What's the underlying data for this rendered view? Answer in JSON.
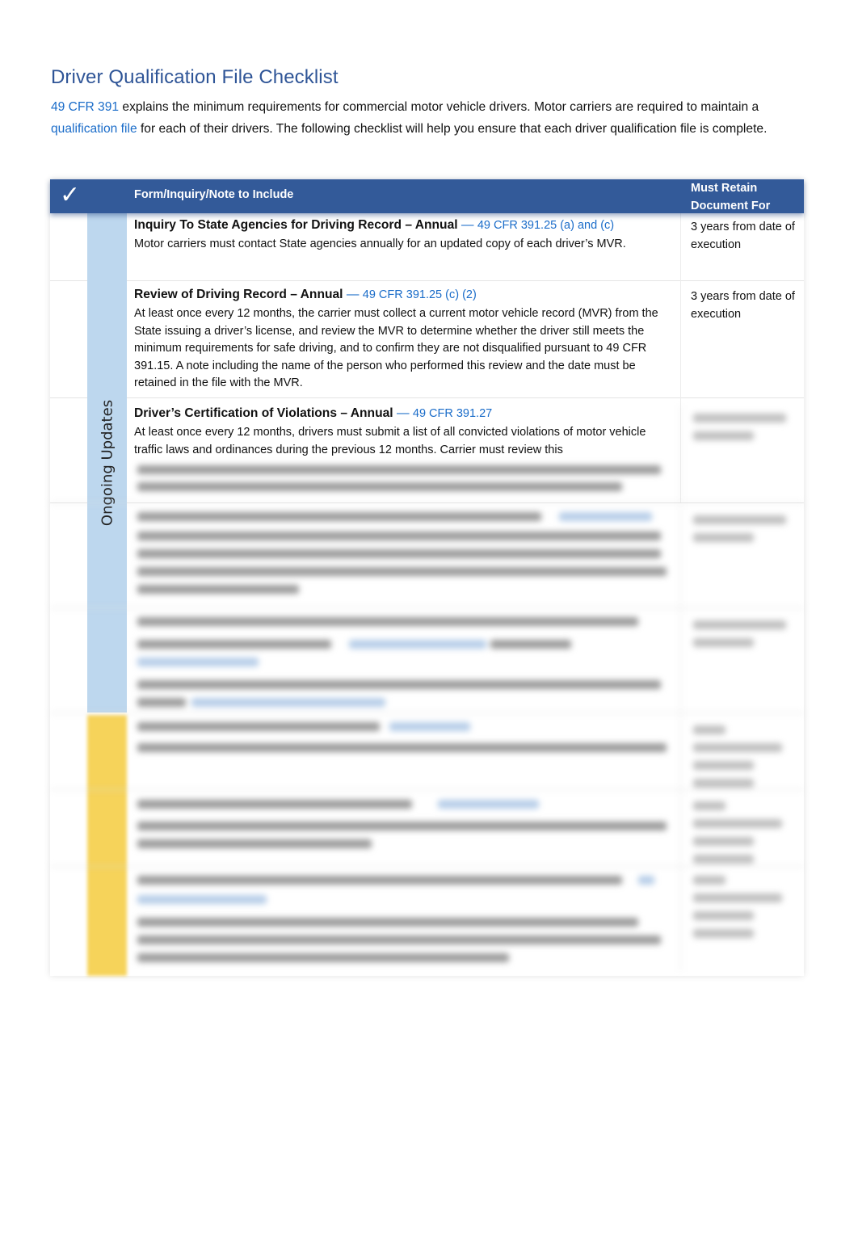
{
  "document": {
    "title": "Driver Qualification File Checklist",
    "intro": {
      "link_1": "49 CFR 391",
      "text_1": " explains the minimum requirements for commercial motor vehicle drivers. Motor carriers are required to maintain a ",
      "link_2": "qualification file",
      "text_2": " for each of their drivers. The following checklist will help you ensure that each driver qualification file is complete."
    }
  },
  "table": {
    "header": {
      "check_icon": "✓",
      "form_column": "Form/Inquiry/Note to Include",
      "retain_column_line1": "Must Retain",
      "retain_column_line2": "Document For"
    },
    "sections": [
      {
        "label": "Ongoing Updates",
        "color": "#bdd7ee"
      },
      {
        "label": "",
        "color": "#f6d35a",
        "blurred": true
      }
    ],
    "rows": [
      {
        "title": "Inquiry To State Agencies for Driving Record – Annual",
        "separator": " — ",
        "reference": "49 CFR 391.25 (a) and (c)",
        "description": "Motor carriers must contact State agencies annually for an updated copy of each driver’s MVR.",
        "retain": "3 years from date of execution"
      },
      {
        "title": "Review of Driving Record – Annual",
        "separator": " — ",
        "reference": "49 CFR 391.25 (c) (2)",
        "description": "At least once every 12 months, the carrier must collect a current motor vehicle record (MVR) from the State issuing a driver’s license, and review the MVR to determine whether the driver still meets the minimum requirements for safe driving, and to confirm they are not disqualified pursuant to 49 CFR 391.15. A note including the name of the person who performed this review and the date must be retained in the file with the MVR.",
        "retain": "3 years from date of execution"
      },
      {
        "title": "Driver’s Certification of Violations – Annual",
        "separator": " — ",
        "reference": "49 CFR 391.27",
        "description": "At least once every 12 months, drivers must submit a list of all convicted violations of motor vehicle traffic laws and ordinances during the previous 12 months. Carrier must review this",
        "retain": ""
      }
    ],
    "blurred_rows_count": 5
  },
  "colors": {
    "title": "#2f5597",
    "header_bg": "#335a99",
    "link": "#1a6cc9",
    "ongoing_rail": "#bdd7ee",
    "second_rail": "#f6d35a"
  }
}
